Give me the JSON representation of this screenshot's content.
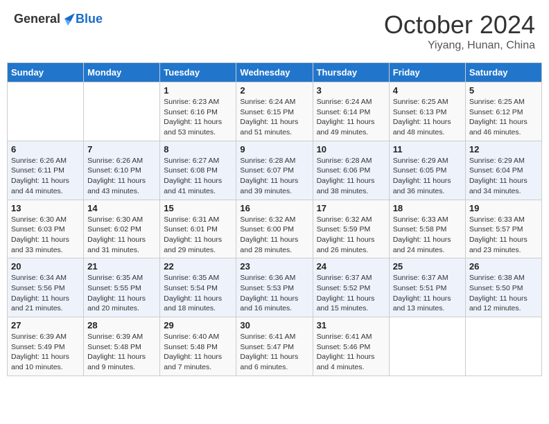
{
  "header": {
    "logo_general": "General",
    "logo_blue": "Blue",
    "title": "October 2024",
    "subtitle": "Yiyang, Hunan, China"
  },
  "days_of_week": [
    "Sunday",
    "Monday",
    "Tuesday",
    "Wednesday",
    "Thursday",
    "Friday",
    "Saturday"
  ],
  "weeks": [
    [
      {
        "day": "",
        "sunrise": "",
        "sunset": "",
        "daylight": "",
        "empty": true
      },
      {
        "day": "",
        "sunrise": "",
        "sunset": "",
        "daylight": "",
        "empty": true
      },
      {
        "day": "1",
        "sunrise": "Sunrise: 6:23 AM",
        "sunset": "Sunset: 6:16 PM",
        "daylight": "Daylight: 11 hours and 53 minutes."
      },
      {
        "day": "2",
        "sunrise": "Sunrise: 6:24 AM",
        "sunset": "Sunset: 6:15 PM",
        "daylight": "Daylight: 11 hours and 51 minutes."
      },
      {
        "day": "3",
        "sunrise": "Sunrise: 6:24 AM",
        "sunset": "Sunset: 6:14 PM",
        "daylight": "Daylight: 11 hours and 49 minutes."
      },
      {
        "day": "4",
        "sunrise": "Sunrise: 6:25 AM",
        "sunset": "Sunset: 6:13 PM",
        "daylight": "Daylight: 11 hours and 48 minutes."
      },
      {
        "day": "5",
        "sunrise": "Sunrise: 6:25 AM",
        "sunset": "Sunset: 6:12 PM",
        "daylight": "Daylight: 11 hours and 46 minutes."
      }
    ],
    [
      {
        "day": "6",
        "sunrise": "Sunrise: 6:26 AM",
        "sunset": "Sunset: 6:11 PM",
        "daylight": "Daylight: 11 hours and 44 minutes."
      },
      {
        "day": "7",
        "sunrise": "Sunrise: 6:26 AM",
        "sunset": "Sunset: 6:10 PM",
        "daylight": "Daylight: 11 hours and 43 minutes."
      },
      {
        "day": "8",
        "sunrise": "Sunrise: 6:27 AM",
        "sunset": "Sunset: 6:08 PM",
        "daylight": "Daylight: 11 hours and 41 minutes."
      },
      {
        "day": "9",
        "sunrise": "Sunrise: 6:28 AM",
        "sunset": "Sunset: 6:07 PM",
        "daylight": "Daylight: 11 hours and 39 minutes."
      },
      {
        "day": "10",
        "sunrise": "Sunrise: 6:28 AM",
        "sunset": "Sunset: 6:06 PM",
        "daylight": "Daylight: 11 hours and 38 minutes."
      },
      {
        "day": "11",
        "sunrise": "Sunrise: 6:29 AM",
        "sunset": "Sunset: 6:05 PM",
        "daylight": "Daylight: 11 hours and 36 minutes."
      },
      {
        "day": "12",
        "sunrise": "Sunrise: 6:29 AM",
        "sunset": "Sunset: 6:04 PM",
        "daylight": "Daylight: 11 hours and 34 minutes."
      }
    ],
    [
      {
        "day": "13",
        "sunrise": "Sunrise: 6:30 AM",
        "sunset": "Sunset: 6:03 PM",
        "daylight": "Daylight: 11 hours and 33 minutes."
      },
      {
        "day": "14",
        "sunrise": "Sunrise: 6:30 AM",
        "sunset": "Sunset: 6:02 PM",
        "daylight": "Daylight: 11 hours and 31 minutes."
      },
      {
        "day": "15",
        "sunrise": "Sunrise: 6:31 AM",
        "sunset": "Sunset: 6:01 PM",
        "daylight": "Daylight: 11 hours and 29 minutes."
      },
      {
        "day": "16",
        "sunrise": "Sunrise: 6:32 AM",
        "sunset": "Sunset: 6:00 PM",
        "daylight": "Daylight: 11 hours and 28 minutes."
      },
      {
        "day": "17",
        "sunrise": "Sunrise: 6:32 AM",
        "sunset": "Sunset: 5:59 PM",
        "daylight": "Daylight: 11 hours and 26 minutes."
      },
      {
        "day": "18",
        "sunrise": "Sunrise: 6:33 AM",
        "sunset": "Sunset: 5:58 PM",
        "daylight": "Daylight: 11 hours and 24 minutes."
      },
      {
        "day": "19",
        "sunrise": "Sunrise: 6:33 AM",
        "sunset": "Sunset: 5:57 PM",
        "daylight": "Daylight: 11 hours and 23 minutes."
      }
    ],
    [
      {
        "day": "20",
        "sunrise": "Sunrise: 6:34 AM",
        "sunset": "Sunset: 5:56 PM",
        "daylight": "Daylight: 11 hours and 21 minutes."
      },
      {
        "day": "21",
        "sunrise": "Sunrise: 6:35 AM",
        "sunset": "Sunset: 5:55 PM",
        "daylight": "Daylight: 11 hours and 20 minutes."
      },
      {
        "day": "22",
        "sunrise": "Sunrise: 6:35 AM",
        "sunset": "Sunset: 5:54 PM",
        "daylight": "Daylight: 11 hours and 18 minutes."
      },
      {
        "day": "23",
        "sunrise": "Sunrise: 6:36 AM",
        "sunset": "Sunset: 5:53 PM",
        "daylight": "Daylight: 11 hours and 16 minutes."
      },
      {
        "day": "24",
        "sunrise": "Sunrise: 6:37 AM",
        "sunset": "Sunset: 5:52 PM",
        "daylight": "Daylight: 11 hours and 15 minutes."
      },
      {
        "day": "25",
        "sunrise": "Sunrise: 6:37 AM",
        "sunset": "Sunset: 5:51 PM",
        "daylight": "Daylight: 11 hours and 13 minutes."
      },
      {
        "day": "26",
        "sunrise": "Sunrise: 6:38 AM",
        "sunset": "Sunset: 5:50 PM",
        "daylight": "Daylight: 11 hours and 12 minutes."
      }
    ],
    [
      {
        "day": "27",
        "sunrise": "Sunrise: 6:39 AM",
        "sunset": "Sunset: 5:49 PM",
        "daylight": "Daylight: 11 hours and 10 minutes."
      },
      {
        "day": "28",
        "sunrise": "Sunrise: 6:39 AM",
        "sunset": "Sunset: 5:48 PM",
        "daylight": "Daylight: 11 hours and 9 minutes."
      },
      {
        "day": "29",
        "sunrise": "Sunrise: 6:40 AM",
        "sunset": "Sunset: 5:48 PM",
        "daylight": "Daylight: 11 hours and 7 minutes."
      },
      {
        "day": "30",
        "sunrise": "Sunrise: 6:41 AM",
        "sunset": "Sunset: 5:47 PM",
        "daylight": "Daylight: 11 hours and 6 minutes."
      },
      {
        "day": "31",
        "sunrise": "Sunrise: 6:41 AM",
        "sunset": "Sunset: 5:46 PM",
        "daylight": "Daylight: 11 hours and 4 minutes."
      },
      {
        "day": "",
        "sunrise": "",
        "sunset": "",
        "daylight": "",
        "empty": true
      },
      {
        "day": "",
        "sunrise": "",
        "sunset": "",
        "daylight": "",
        "empty": true
      }
    ]
  ]
}
